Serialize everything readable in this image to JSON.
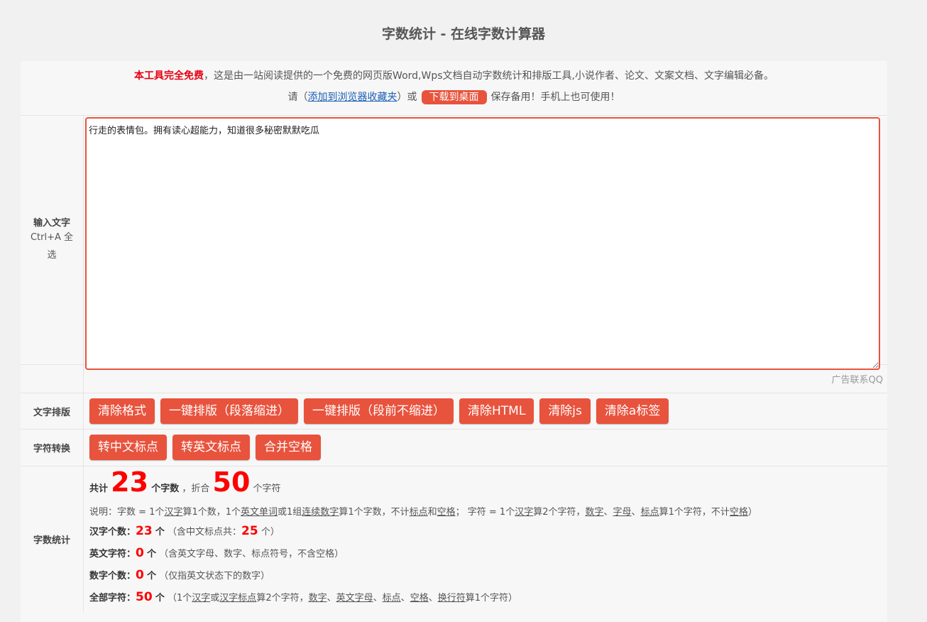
{
  "title": "字数统计 - 在线字数计算器",
  "notice": {
    "free": "本工具完全免费",
    "desc": "，这是由一站阅读提供的一个免费的网页版Word,Wps文档自动字数统计和排版工具,小说作者、论文、文案文档、文字编辑必备。",
    "please": "请（",
    "bookmark": "添加到浏览器收藏夹",
    "or": "）或",
    "download": "下载到桌面",
    "save": "保存备用！手机上也可使用！"
  },
  "input": {
    "label": "输入文字",
    "sub1": "Ctrl+A 全",
    "sub2": "选",
    "value": "行走的表情包。拥有读心超能力，知道很多秘密默默吃瓜"
  },
  "ad": "广告联系QQ",
  "typeset": {
    "label": "文字排版",
    "buttons": [
      "清除格式",
      "一键排版（段落缩进）",
      "一键排版（段前不缩进）",
      "清除HTML",
      "清除js",
      "清除a标签"
    ]
  },
  "convert": {
    "label": "字符转换",
    "buttons": [
      "转中文标点",
      "转英文标点",
      "合并空格"
    ]
  },
  "stats": {
    "label": "字数统计",
    "total_prefix": "共计",
    "word_count": "23",
    "word_unit": "个字数",
    "sep": "，折合",
    "char_count": "50",
    "char_unit": "个字符",
    "explain": [
      {
        "t": "说明：字数 = 1个"
      },
      {
        "t": "汉字",
        "u": true
      },
      {
        "t": "算1个数，1个"
      },
      {
        "t": "英文单词",
        "u": true
      },
      {
        "t": "或1组"
      },
      {
        "t": "连续数字",
        "u": true
      },
      {
        "t": "算1个字数，不计"
      },
      {
        "t": "标点",
        "u": true
      },
      {
        "t": "和"
      },
      {
        "t": "空格",
        "u": true
      },
      {
        "t": "；  字符 = 1个"
      },
      {
        "t": "汉字",
        "u": true
      },
      {
        "t": "算2个字符，"
      },
      {
        "t": "数字",
        "u": true
      },
      {
        "t": "、"
      },
      {
        "t": "字母",
        "u": true
      },
      {
        "t": "、"
      },
      {
        "t": "标点",
        "u": true
      },
      {
        "t": "算1个字符，不计"
      },
      {
        "t": "空格",
        "u": true
      },
      {
        "t": "）"
      }
    ],
    "hanzi_label": "汉字个数：",
    "hanzi_value": "23",
    "unit": "个",
    "hanzi_note_a": "（含中文标点共：",
    "hanzi_note_value": "25",
    "hanzi_note_b": "个）",
    "en_label": "英文字符：",
    "en_value": "0",
    "en_note": "（含英文字母、数字、标点符号，不含空格）",
    "num_label": "数字个数：",
    "num_value": "0",
    "num_note": "（仅指英文状态下的数字）",
    "all_label": "全部字符：",
    "all_value": "50",
    "all_note": [
      {
        "t": "（1个"
      },
      {
        "t": "汉字",
        "u": true
      },
      {
        "t": "或"
      },
      {
        "t": "汉字标点",
        "u": true
      },
      {
        "t": "算2个字符，"
      },
      {
        "t": "数字",
        "u": true
      },
      {
        "t": "、"
      },
      {
        "t": "英文字母",
        "u": true
      },
      {
        "t": "、"
      },
      {
        "t": "标点",
        "u": true
      },
      {
        "t": "、"
      },
      {
        "t": "空格",
        "u": true
      },
      {
        "t": "、"
      },
      {
        "t": "换行符",
        "u": true
      },
      {
        "t": "算1个字符）"
      }
    ]
  }
}
